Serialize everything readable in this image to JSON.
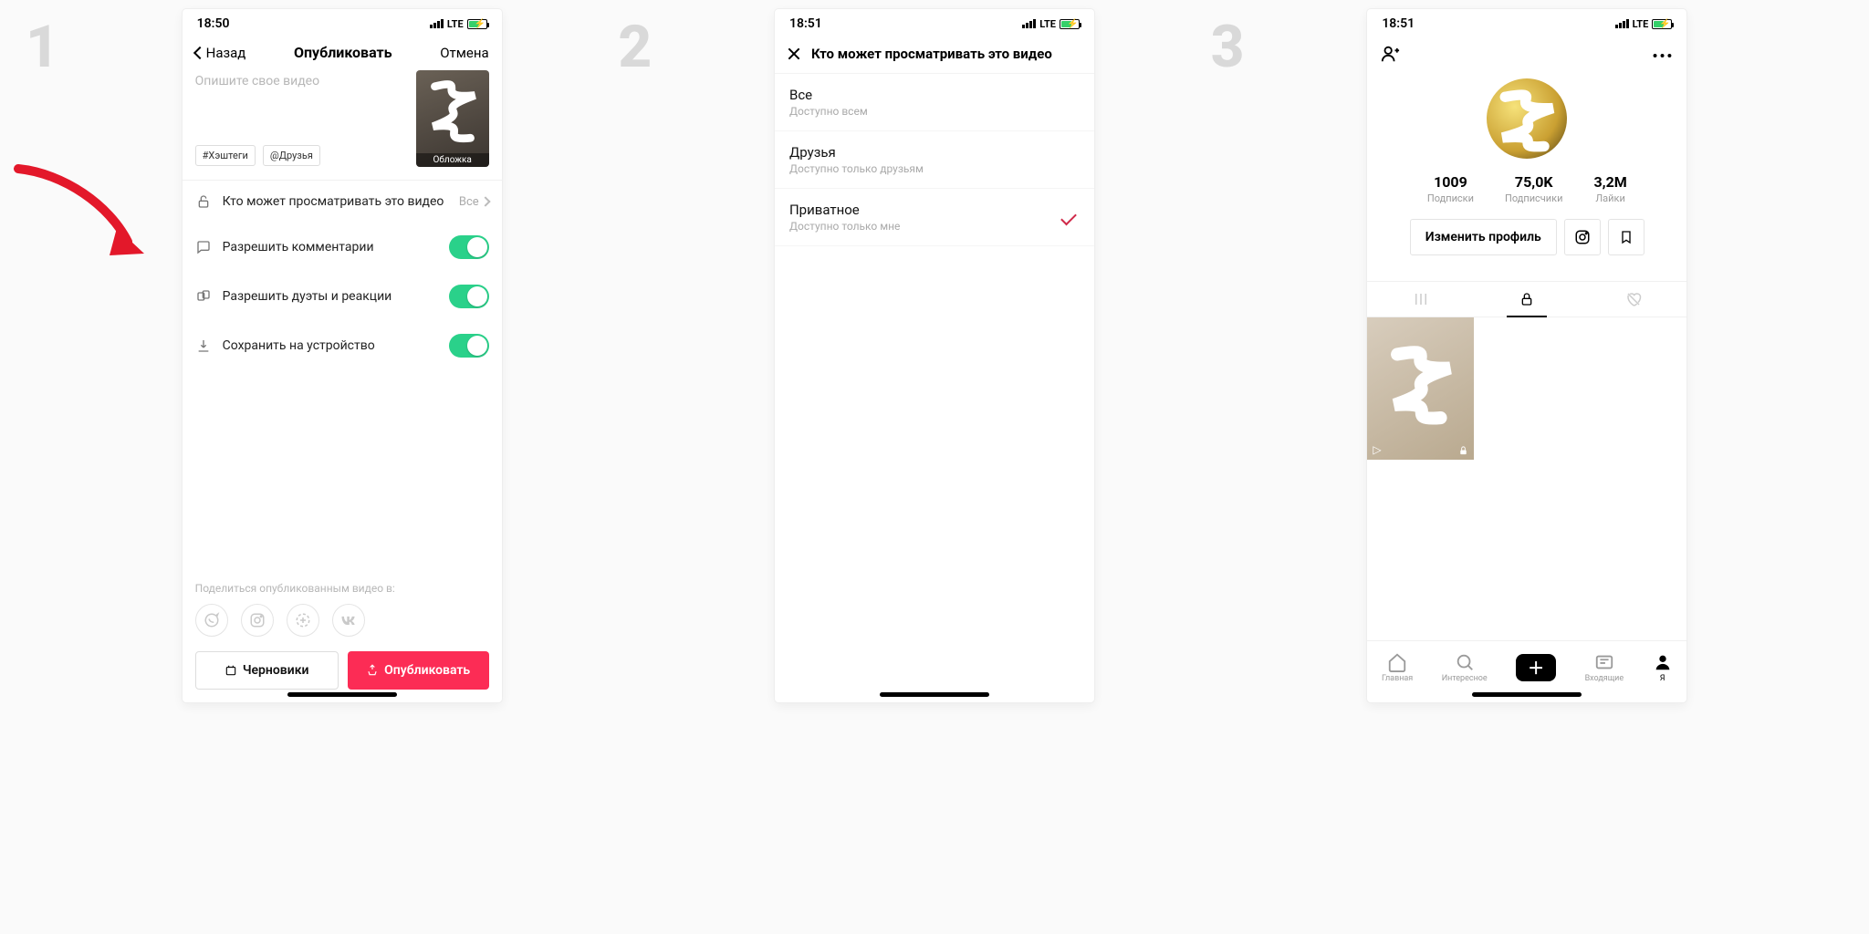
{
  "steps": [
    "1",
    "2",
    "3"
  ],
  "status_time_a": "18:50",
  "status_time_b": "18:51",
  "status_net": "LTE",
  "screen1": {
    "back": "Назад",
    "title": "Опубликовать",
    "cancel": "Отмена",
    "placeholder": "Опишите свое видео",
    "chip_hashtags": "#Хэштеги",
    "chip_friends": "@Друзья",
    "cover_label": "Обложка",
    "row_privacy": "Кто может просматривать это видео",
    "row_privacy_value": "Все",
    "row_comments": "Разрешить комментарии",
    "row_duets": "Разрешить дуэты и реакции",
    "row_save": "Сохранить на устройство",
    "share_label": "Поделиться опубликованным видео в:",
    "btn_drafts": "Черновики",
    "btn_publish": "Опубликовать"
  },
  "screen2": {
    "title": "Кто может просматривать это видео",
    "opts": [
      {
        "main": "Все",
        "sub": "Доступно всем",
        "checked": false
      },
      {
        "main": "Друзья",
        "sub": "Доступно только друзьям",
        "checked": false
      },
      {
        "main": "Приватное",
        "sub": "Доступно только мне",
        "checked": true
      }
    ]
  },
  "screen3": {
    "stats": [
      {
        "num": "1009",
        "lbl": "Подписки"
      },
      {
        "num": "75,0K",
        "lbl": "Подписчики"
      },
      {
        "num": "3,2M",
        "lbl": "Лайки"
      }
    ],
    "edit_profile": "Изменить профиль",
    "tabbar": {
      "home": "Главная",
      "discover": "Интересное",
      "inbox": "Входящие",
      "me": "Я"
    }
  }
}
